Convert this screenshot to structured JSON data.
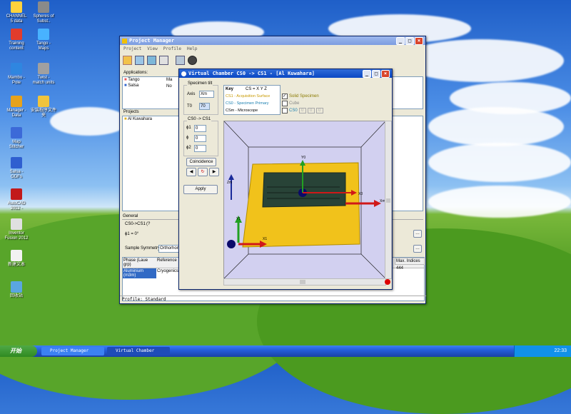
{
  "desktop_icons": [
    {
      "label": "CHANNEL\n5 data",
      "color": "#ffd23c"
    },
    {
      "label": "Spheres of\nSubst..",
      "color": "#8a8a8a"
    },
    {
      "label": "Training\ncontent",
      "color": "#e23c2c"
    },
    {
      "label": "Tango -\nMaps",
      "color": "#48b2ff"
    },
    {
      "label": "Mambo -\nPole",
      "color": "#2f86e0"
    },
    {
      "label": "Twist -\nmatch units",
      "color": "#a0a0a0"
    },
    {
      "label": "Manager -\nData",
      "color": "#e6a21b"
    },
    {
      "label": "安装程序文件\n夹",
      "color": "#f0c43c"
    },
    {
      "label": "Map\nStitcher",
      "color": "#3c6ad8"
    },
    {
      "label": "Salsa -\nODFs",
      "color": "#2f5fd0"
    },
    {
      "label": "AutoCAD\n2012 -",
      "color": "#c21a1a"
    },
    {
      "label": "Inventor\nFusion 2012",
      "color": "#e0e0e0"
    },
    {
      "label": "新建文本",
      "color": "#f2f2f2"
    },
    {
      "label": "回收站",
      "color": "#5aa6e0"
    }
  ],
  "project_manager": {
    "title": "Project Manager",
    "menu": [
      "Project",
      "View",
      "Profile",
      "Help"
    ],
    "applications_label": "Applications:",
    "applications": [
      "Tango",
      "Salsa"
    ],
    "applications_right": [
      "Ma",
      "No"
    ],
    "projects_label": "Projects",
    "projects": [
      "Al Kuwahara"
    ],
    "general_label": "General",
    "cs_label": "CS0->CS1",
    "cs_value": "(?",
    "phi_label": "ϕ1 = 0°",
    "sample_symmetry_label": "Sample Symmetry",
    "sample_symmetry_value": "Orthorhom",
    "phase_headers": [
      "Phase (Laue grp)",
      "Reference"
    ],
    "phase_row": [
      "Aluminium (m3m)",
      "Cryogenics"
    ],
    "max_indices_label": "Max. Indices",
    "max_indices_value": "444",
    "status": "Profile: Standard"
  },
  "virtual_chamber": {
    "title": "Virtual Chamber CS0 -> CS1 - [Al Kuwahara]",
    "specimen_tilt_label": "Specimen tilt",
    "axis_label": "Axis",
    "axis_value": "Xm",
    "t0_label": "T0",
    "t0_value": "70",
    "cs_group_label": "CS0 -> CS1",
    "phi1_label": "ϕ1",
    "phi1_value": "0",
    "phi_label": "ϕ",
    "phi_value": "0",
    "phi2_label": "ϕ2",
    "phi2_value": "0",
    "coincidence_label": "Coincidence",
    "apply_label": "Apply",
    "key_title": "Key",
    "key_axes": "CS = X Y Z",
    "key_items": [
      "CS1 - Acquisition Surface",
      "CS0 - Specimen Primary",
      "CSm - Microscope"
    ],
    "key_colors": [
      "#c89a00",
      "#1a7fb0",
      "#000000"
    ],
    "solid_specimen_label": "Solid Specimen",
    "cube_label": "Cube",
    "cs0_label": "CS0",
    "cs0_values": [
      "0",
      "0",
      "0"
    ],
    "axis_labels": [
      "Y0",
      "Xm",
      "X0",
      "Zm",
      "Y1",
      "X1"
    ]
  },
  "taskbar": {
    "start": "开始",
    "tasks": [
      "Project Manager",
      "Virtual Chamber"
    ],
    "clock": "22:33"
  }
}
